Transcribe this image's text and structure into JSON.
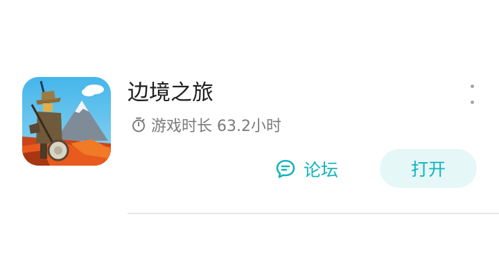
{
  "game": {
    "title": "边境之旅",
    "playtime": "游戏时长 63.2小时"
  },
  "actions": {
    "forum_label": "论坛",
    "open_label": "打开"
  },
  "icons": {
    "playtime": "stopwatch-icon",
    "forum": "chat-bubble-icon",
    "more": "more-vertical-icon"
  },
  "colors": {
    "accent": "#12b3bd",
    "open_button_bg": "#e6f7f8",
    "title": "#1f1f1f",
    "secondary_text": "#7a7a7a"
  }
}
